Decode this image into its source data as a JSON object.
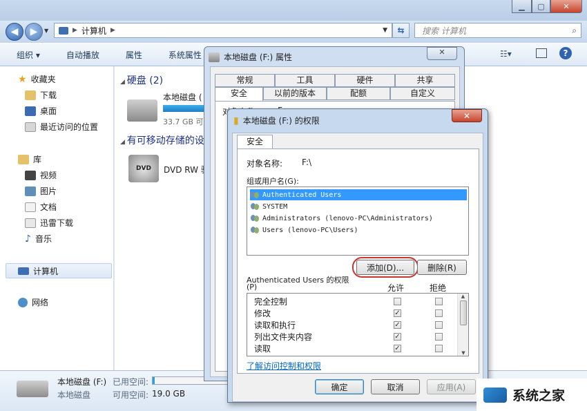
{
  "explorer": {
    "breadcrumb": [
      "计算机"
    ],
    "search_placeholder": "搜索 计算机",
    "toolbar": [
      "组织 ▾",
      "自动播放",
      "属性",
      "系统属性"
    ],
    "sidebar": {
      "favorites_header": "收藏夹",
      "favorites": [
        "下载",
        "桌面",
        "最近访问的位置"
      ],
      "libraries_header": "库",
      "libraries": [
        "视频",
        "图片",
        "文档",
        "迅雷下载",
        "音乐"
      ],
      "computer": "计算机",
      "network": "网络"
    },
    "groups": {
      "hdd_header": "硬盘 (2)",
      "removable_header": "有可移动存储的设"
    },
    "drive_f": {
      "label": "本地磁盘 (",
      "free": "33.7 GB 可"
    },
    "dvd": {
      "label": "DVD RW 驱",
      "icon_text": "DVD"
    },
    "details": {
      "name": "本地磁盘 (F:)",
      "type": "本地磁盘",
      "used_label": "已用空间:",
      "free_label": "可用空间:",
      "free_value": "19.0 GB"
    }
  },
  "properties": {
    "title": "本地磁盘 (F:) 属性",
    "tabs_row1": [
      "常规",
      "工具",
      "硬件",
      "共享"
    ],
    "tabs_row2": [
      "安全",
      "以前的版本",
      "配额",
      "自定义"
    ],
    "object_label": "对象名称:",
    "object_value": "F:"
  },
  "permissions": {
    "title": "本地磁盘 (F:) 的权限",
    "tab": "安全",
    "object_label": "对象名称:",
    "object_value": "F:\\",
    "group_label": "组或用户名(G):",
    "users": [
      "Authenticated Users",
      "SYSTEM",
      "Administrators (lenovo-PC\\Administrators)",
      "Users (lenovo-PC\\Users)"
    ],
    "add_button": "添加(D)...",
    "remove_button": "删除(R)",
    "perm_header": "Authenticated Users 的权限",
    "perm_header_p": "(P)",
    "allow_label": "允许",
    "deny_label": "拒绝",
    "perms": [
      {
        "name": "完全控制",
        "allow": false,
        "deny": false
      },
      {
        "name": "修改",
        "allow": true,
        "deny": false
      },
      {
        "name": "读取和执行",
        "allow": true,
        "deny": false
      },
      {
        "name": "列出文件夹内容",
        "allow": true,
        "deny": false
      },
      {
        "name": "读取",
        "allow": true,
        "deny": false
      }
    ],
    "link": "了解访问控制和权限",
    "ok": "确定",
    "cancel": "取消",
    "apply": "应用(A)"
  },
  "watermark": {
    "text": "系统之家"
  }
}
